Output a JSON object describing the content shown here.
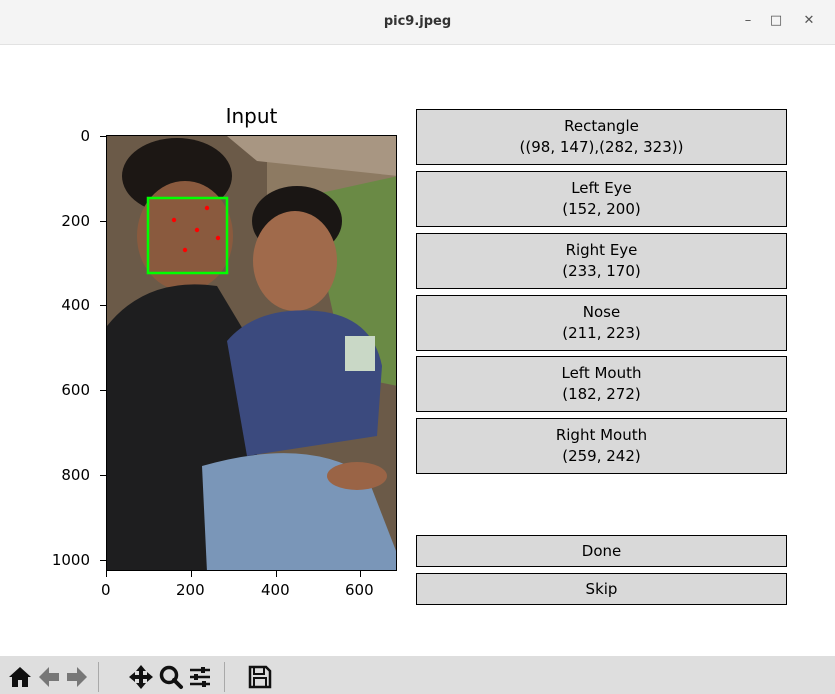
{
  "window": {
    "title": "pic9.jpeg",
    "minimize_glyph": "–",
    "maximize_glyph": "□",
    "close_glyph": "✕"
  },
  "plot": {
    "title": "Input",
    "y_ticks": [
      "0",
      "200",
      "400",
      "600",
      "800",
      "1000"
    ],
    "x_ticks": [
      "0",
      "200",
      "400",
      "600"
    ],
    "face_box_color": "#00ff00",
    "landmark_color": "#ff0000"
  },
  "buttons": {
    "rectangle": {
      "label": "Rectangle",
      "value": "((98, 147),(282, 323))"
    },
    "left_eye": {
      "label": "Left Eye",
      "value": "(152, 200)"
    },
    "right_eye": {
      "label": "Right Eye",
      "value": "(233, 170)"
    },
    "nose": {
      "label": "Nose",
      "value": "(211, 223)"
    },
    "left_mouth": {
      "label": "Left Mouth",
      "value": "(182, 272)"
    },
    "right_mouth": {
      "label": "Right Mouth",
      "value": "(259, 242)"
    },
    "done": "Done",
    "skip": "Skip"
  },
  "toolbar": {
    "icons": [
      "home-icon",
      "back-arrow-icon",
      "forward-arrow-icon",
      "pan-icon",
      "zoom-icon",
      "configure-subplots-icon",
      "save-icon"
    ]
  }
}
